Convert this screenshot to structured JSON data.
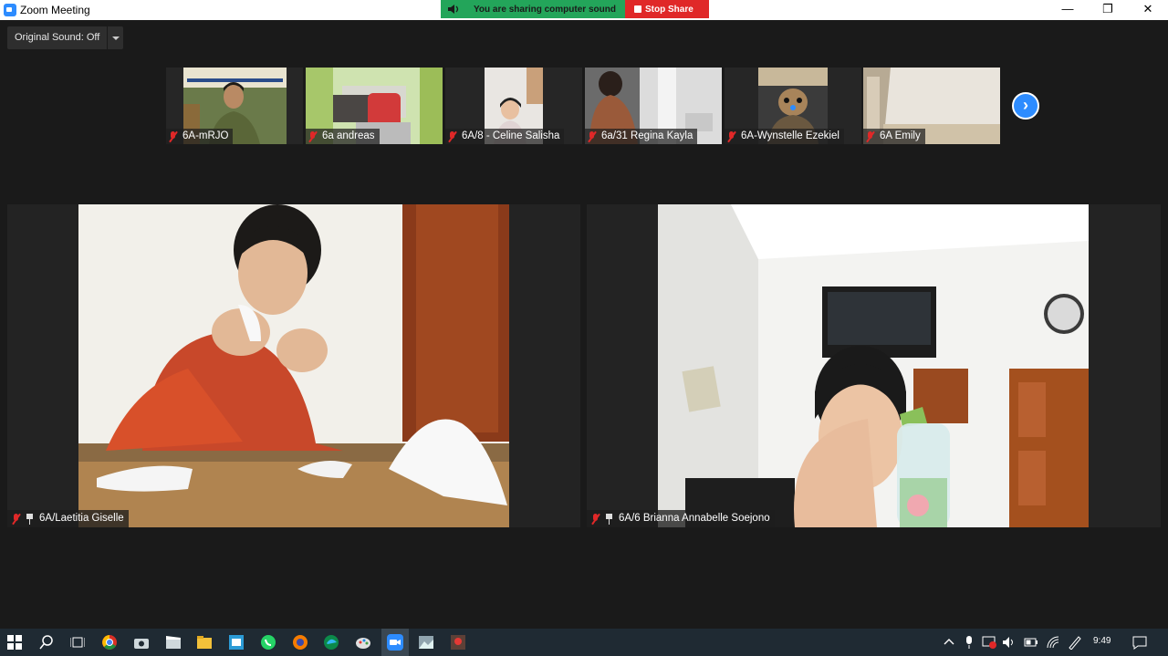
{
  "window": {
    "title": "Zoom Meeting",
    "minimize": "—",
    "maximize": "❐",
    "close": "✕"
  },
  "share_banner": {
    "status": "You are sharing computer sound",
    "stop_label": "Stop Share"
  },
  "original_sound": {
    "label": "Original Sound: Off"
  },
  "thumbnails": [
    {
      "name": "6A-mRJO"
    },
    {
      "name": "6a andreas"
    },
    {
      "name": "6A/8 - Celine Salisha"
    },
    {
      "name": "6a/31 Regina Kayla"
    },
    {
      "name": "6A-Wynstelle Ezekiel"
    },
    {
      "name": "6A Emily"
    }
  ],
  "next_arrow": "›",
  "panels": [
    {
      "name": "6A/Laetitia Giselle"
    },
    {
      "name": "6A/6 Brianna Annabelle Soejono"
    }
  ],
  "taskbar": {
    "time": "9:49"
  },
  "colors": {
    "share_green": "#23a55a",
    "stop_red": "#e02828",
    "zoom_blue": "#2d8cff",
    "background": "#1a1a1a"
  }
}
